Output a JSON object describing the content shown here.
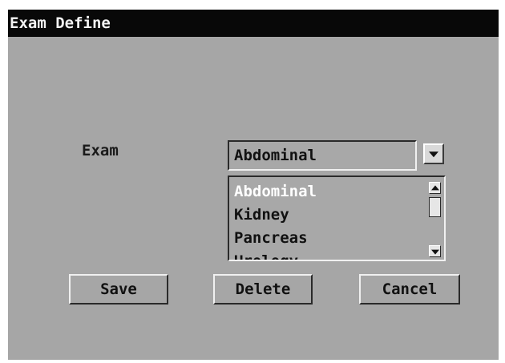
{
  "window": {
    "title": "Exam Define"
  },
  "form": {
    "exam_label": "Exam",
    "combo_value": "Abdominal",
    "list_items": [
      "Abdominal",
      "Kidney",
      "Pancreas",
      "Urology"
    ],
    "selected_item": "Abdominal"
  },
  "buttons": {
    "save": "Save",
    "delete": "Delete",
    "cancel": "Cancel"
  },
  "icons": {
    "dropdown": "chevron-down-icon",
    "scroll_up": "scroll-up-arrow-icon",
    "scroll_down": "scroll-down-arrow-icon"
  },
  "colors": {
    "titlebar_bg": "#080808",
    "titlebar_text": "#f2f2f2",
    "window_bg": "#a6a6a6",
    "selected_text": "#ffffff"
  }
}
